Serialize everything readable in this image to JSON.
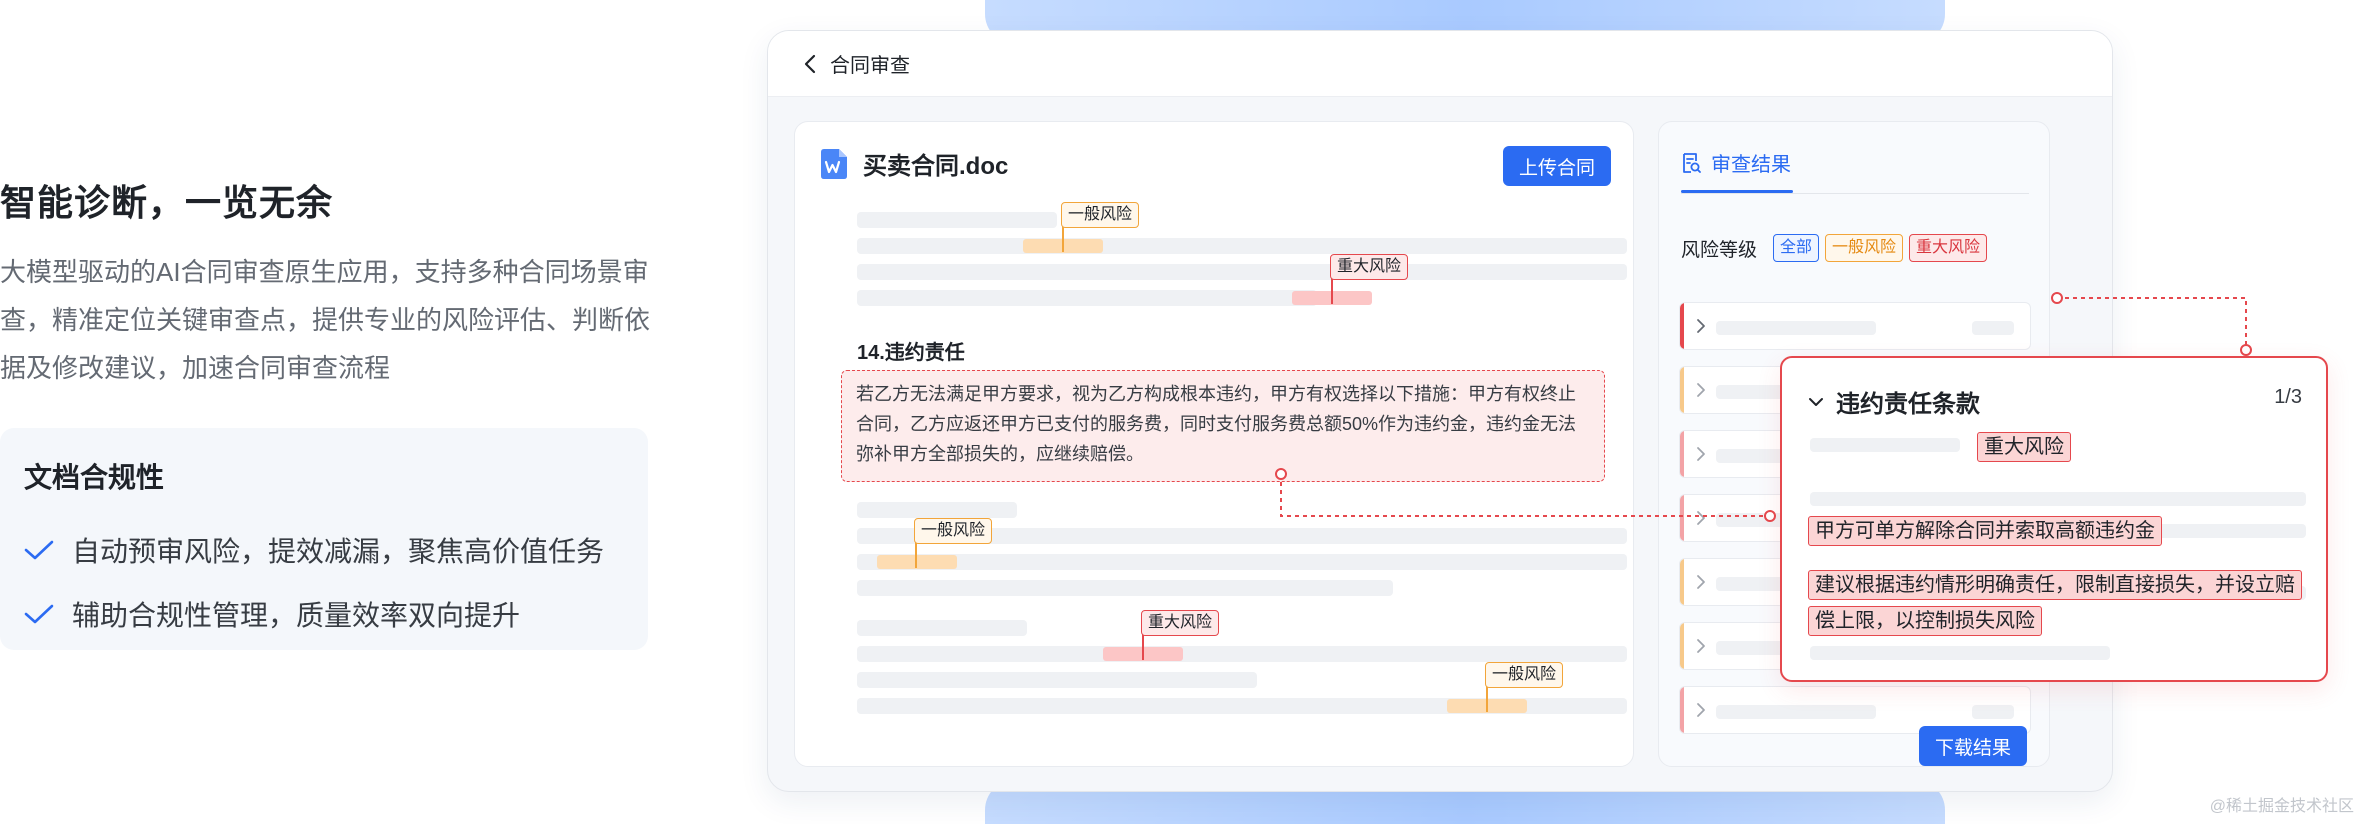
{
  "hero": {
    "title": "智能诊断，一览无余",
    "description": "大模型驱动的AI合同审查原生应用，支持多种合同场景审查，精准定位关键审查点，提供专业的风险评估、判断依据及修改建议，加速合同审查流程"
  },
  "feature": {
    "title": "文档合规性",
    "items": [
      "自动预审风险，提效减漏，聚焦高价值任务",
      "辅助合规性管理，质量效率双向提升"
    ]
  },
  "window": {
    "title": "合同审查"
  },
  "document": {
    "file_name": "买卖合同.doc",
    "upload_label": "上传合同",
    "clause_heading": "14.违约责任",
    "clause_text": "若乙方无法满足甲方要求，视为乙方构成根本违约，甲方有权选择以下措施：甲方有权终止合同，乙方应返还甲方已支付的服务费，同时支付服务费总额50%作为违约金，违约金无法弥补甲方全部损失的，应继续赔偿。",
    "tags": [
      "一般风险",
      "重大风险",
      "一般风险",
      "重大风险",
      "一般风险"
    ]
  },
  "results": {
    "tab_label": "审查结果",
    "risk_label": "风险等级",
    "filters": [
      "全部",
      "一般风险",
      "重大风险"
    ],
    "download_label": "下载结果"
  },
  "popover": {
    "title": "违约责任条款",
    "counter": "1/3",
    "risk_tag": "重大风险",
    "finding": "甲方可单方解除合同并索取高额违约金",
    "suggestion_line1": "建议根据违约情形明确责任，限制直接损失，并设立赔",
    "suggestion_line2": "偿上限，以控制损失风险"
  },
  "watermark": "@稀土掘金技术社区",
  "colors": {
    "primary": "#2b6bf2",
    "warning": "#f2a53a",
    "danger": "#e5484d"
  }
}
